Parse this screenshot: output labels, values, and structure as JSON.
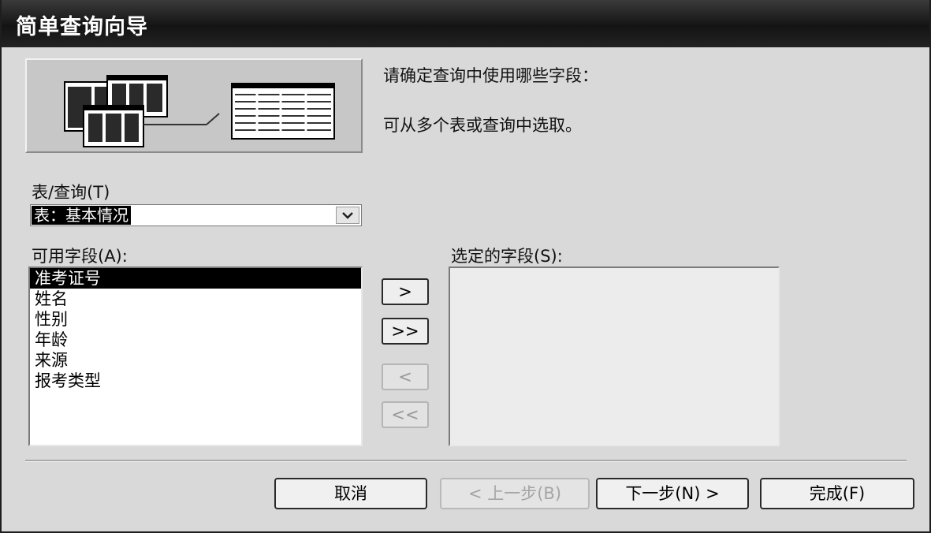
{
  "window": {
    "title": "简单查询向导"
  },
  "instructions": {
    "line1": "请确定查询中使用哪些字段：",
    "line2": "可从多个表或查询中选取。"
  },
  "table_query": {
    "label": "表/查询(T)",
    "selected_value": "表：基本情况"
  },
  "available_fields": {
    "label": "可用字段(A):",
    "items": [
      "准考证号",
      "姓名",
      "性别",
      "年龄",
      "来源",
      "报考类型"
    ],
    "selected_index": 0
  },
  "selected_fields": {
    "label": "选定的字段(S):",
    "items": []
  },
  "move_buttons": {
    "add_one": ">",
    "add_all": ">>",
    "remove_one": "<",
    "remove_all": "<<"
  },
  "footer": {
    "cancel": "取消",
    "back": "< 上一步(B)",
    "next": "下一步(N) >",
    "finish": "完成(F)"
  },
  "icons": {
    "dropdown": "chevron-down-icon",
    "wizard_graphic": "table-query-graphic"
  }
}
